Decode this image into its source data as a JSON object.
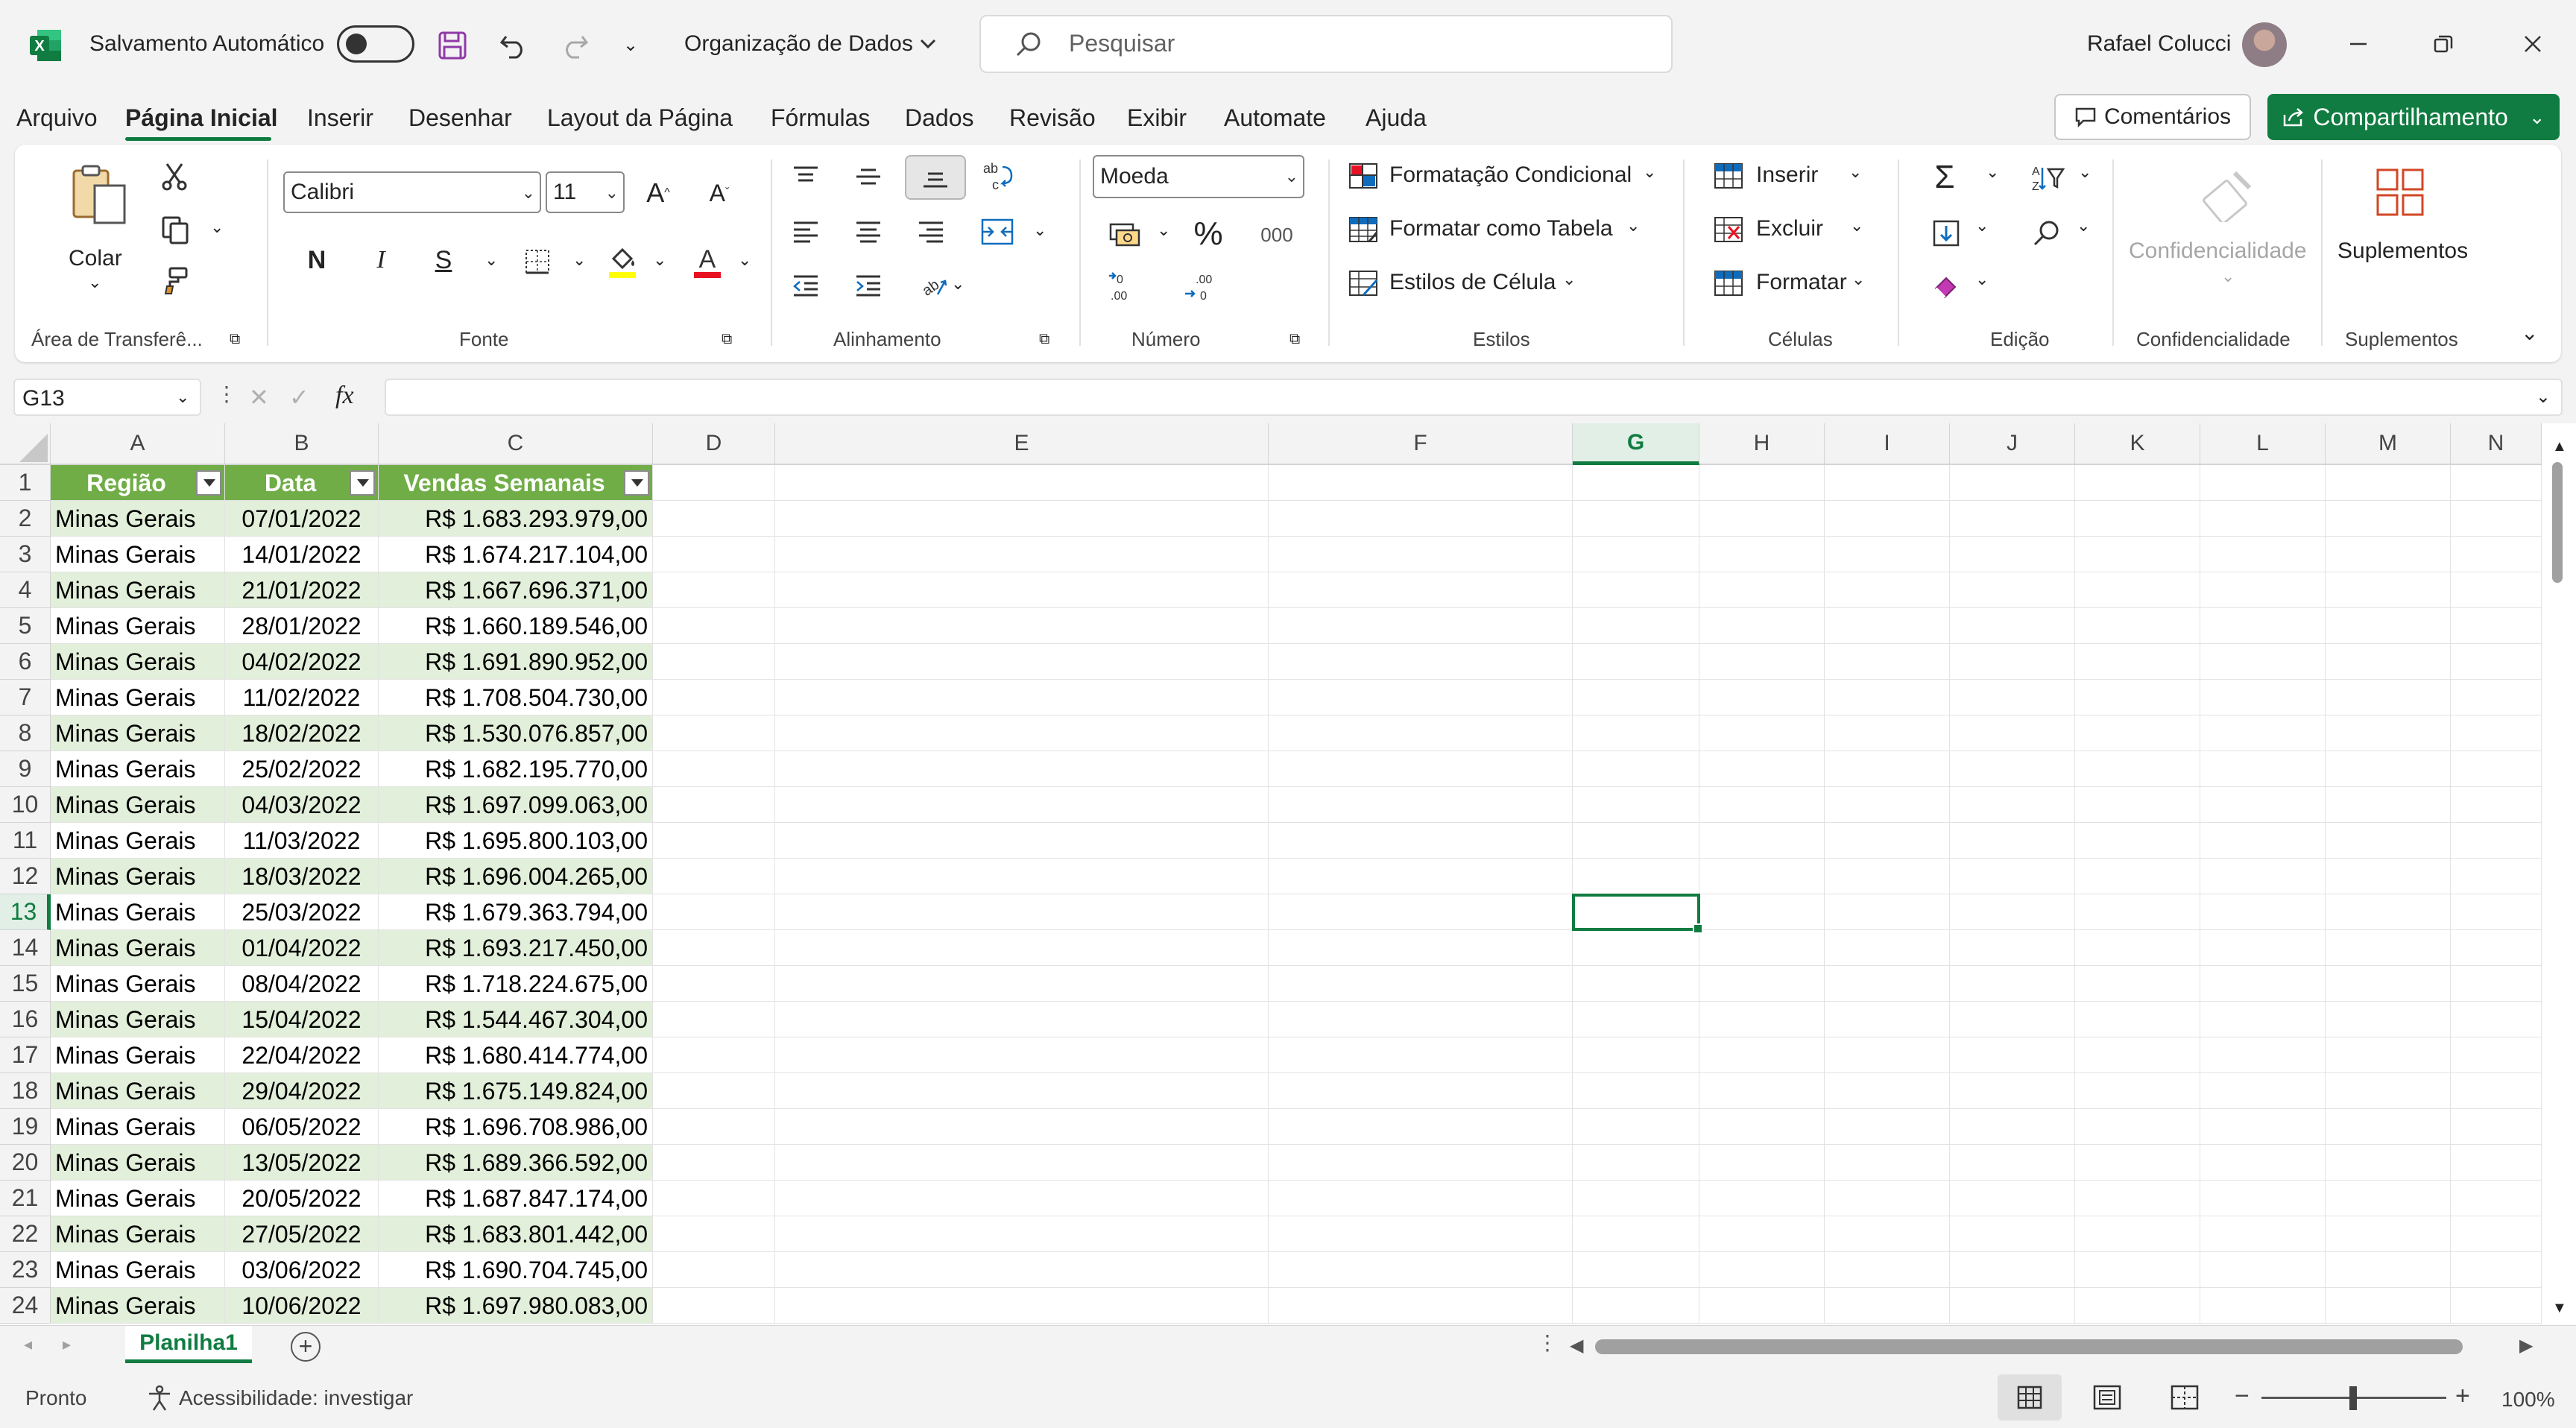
{
  "app": {
    "autosave_label": "Salvamento Automático",
    "document_name": "Organização de Dados",
    "search_placeholder": "Pesquisar",
    "user_name": "Rafael Colucci",
    "brand_color": "#107c41"
  },
  "menu": {
    "items": [
      "Arquivo",
      "Página Inicial",
      "Inserir",
      "Desenhar",
      "Layout da Página",
      "Fórmulas",
      "Dados",
      "Revisão",
      "Exibir",
      "Automate",
      "Ajuda"
    ],
    "active": "Página Inicial",
    "comments_label": "Comentários",
    "share_label": "Compartilhamento"
  },
  "ribbon": {
    "clipboard": {
      "paste_label": "Colar",
      "group_label": "Área de Transferê..."
    },
    "font": {
      "font_name": "Calibri",
      "font_size": "11",
      "bold": "N",
      "italic": "I",
      "underline": "S",
      "group_label": "Fonte"
    },
    "alignment": {
      "group_label": "Alinhamento"
    },
    "number": {
      "format": "Moeda",
      "thousands": "000",
      "group_label": "Número"
    },
    "styles": {
      "conditional": "Formatação Condicional",
      "as_table": "Formatar como Tabela",
      "cell_styles": "Estilos de Célula",
      "group_label": "Estilos"
    },
    "cells": {
      "insert": "Inserir",
      "delete": "Excluir",
      "format": "Formatar",
      "group_label": "Células"
    },
    "editing": {
      "group_label": "Edição"
    },
    "sensitivity": {
      "label": "Confidencialidade",
      "group_label": "Confidencialidade"
    },
    "addins": {
      "label": "Suplementos",
      "group_label": "Suplementos"
    }
  },
  "formula_bar": {
    "name_box": "G13",
    "fx": "fx",
    "value": ""
  },
  "grid": {
    "columns": [
      "A",
      "B",
      "C",
      "D",
      "E",
      "F",
      "G",
      "H",
      "I",
      "J",
      "K",
      "L",
      "M",
      "N"
    ],
    "selected_column": "G",
    "selected_row": "13",
    "table_headers": [
      "Região",
      "Data",
      "Vendas Semanais"
    ],
    "rows": [
      {
        "n": "1"
      },
      {
        "n": "2",
        "a": "Minas Gerais",
        "b": "07/01/2022",
        "c": "R$ 1.683.293.979,00"
      },
      {
        "n": "3",
        "a": "Minas Gerais",
        "b": "14/01/2022",
        "c": "R$ 1.674.217.104,00"
      },
      {
        "n": "4",
        "a": "Minas Gerais",
        "b": "21/01/2022",
        "c": "R$ 1.667.696.371,00"
      },
      {
        "n": "5",
        "a": "Minas Gerais",
        "b": "28/01/2022",
        "c": "R$ 1.660.189.546,00"
      },
      {
        "n": "6",
        "a": "Minas Gerais",
        "b": "04/02/2022",
        "c": "R$ 1.691.890.952,00"
      },
      {
        "n": "7",
        "a": "Minas Gerais",
        "b": "11/02/2022",
        "c": "R$ 1.708.504.730,00"
      },
      {
        "n": "8",
        "a": "Minas Gerais",
        "b": "18/02/2022",
        "c": "R$ 1.530.076.857,00"
      },
      {
        "n": "9",
        "a": "Minas Gerais",
        "b": "25/02/2022",
        "c": "R$ 1.682.195.770,00"
      },
      {
        "n": "10",
        "a": "Minas Gerais",
        "b": "04/03/2022",
        "c": "R$ 1.697.099.063,00"
      },
      {
        "n": "11",
        "a": "Minas Gerais",
        "b": "11/03/2022",
        "c": "R$ 1.695.800.103,00"
      },
      {
        "n": "12",
        "a": "Minas Gerais",
        "b": "18/03/2022",
        "c": "R$ 1.696.004.265,00"
      },
      {
        "n": "13",
        "a": "Minas Gerais",
        "b": "25/03/2022",
        "c": "R$ 1.679.363.794,00"
      },
      {
        "n": "14",
        "a": "Minas Gerais",
        "b": "01/04/2022",
        "c": "R$ 1.693.217.450,00"
      },
      {
        "n": "15",
        "a": "Minas Gerais",
        "b": "08/04/2022",
        "c": "R$ 1.718.224.675,00"
      },
      {
        "n": "16",
        "a": "Minas Gerais",
        "b": "15/04/2022",
        "c": "R$ 1.544.467.304,00"
      },
      {
        "n": "17",
        "a": "Minas Gerais",
        "b": "22/04/2022",
        "c": "R$ 1.680.414.774,00"
      },
      {
        "n": "18",
        "a": "Minas Gerais",
        "b": "29/04/2022",
        "c": "R$ 1.675.149.824,00"
      },
      {
        "n": "19",
        "a": "Minas Gerais",
        "b": "06/05/2022",
        "c": "R$ 1.696.708.986,00"
      },
      {
        "n": "20",
        "a": "Minas Gerais",
        "b": "13/05/2022",
        "c": "R$ 1.689.366.592,00"
      },
      {
        "n": "21",
        "a": "Minas Gerais",
        "b": "20/05/2022",
        "c": "R$ 1.687.847.174,00"
      },
      {
        "n": "22",
        "a": "Minas Gerais",
        "b": "27/05/2022",
        "c": "R$ 1.683.801.442,00"
      },
      {
        "n": "23",
        "a": "Minas Gerais",
        "b": "03/06/2022",
        "c": "R$ 1.690.704.745,00"
      },
      {
        "n": "24",
        "a": "Minas Gerais",
        "b": "10/06/2022",
        "c": "R$ 1.697.980.083,00"
      }
    ]
  },
  "sheets": {
    "tabs": [
      "Planilha1"
    ],
    "active": "Planilha1"
  },
  "status": {
    "ready": "Pronto",
    "accessibility": "Acessibilidade: investigar",
    "zoom": "100%"
  }
}
